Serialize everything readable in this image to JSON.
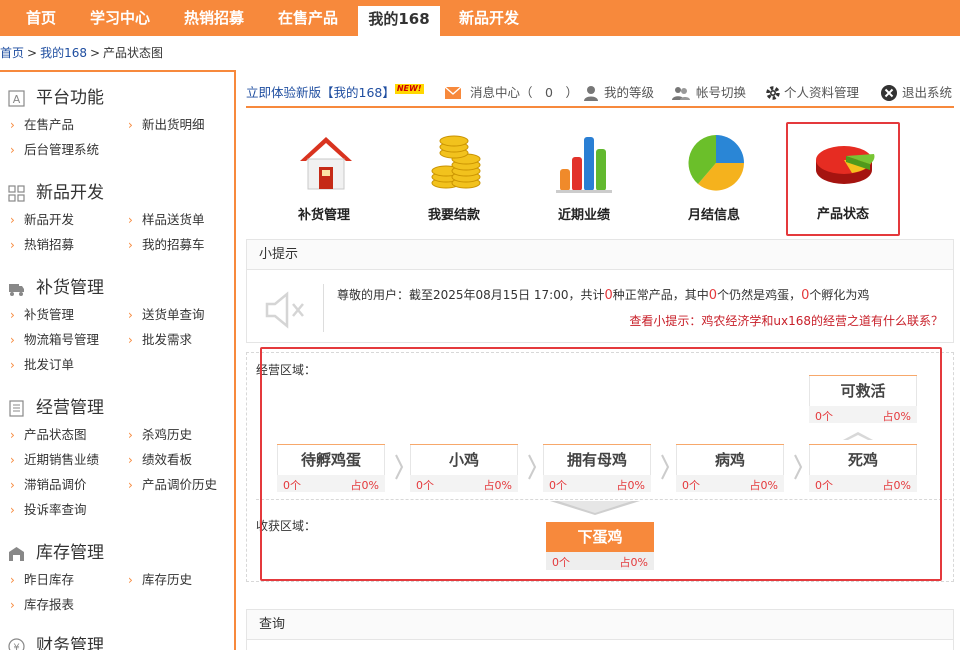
{
  "nav": {
    "tabs": [
      "首页",
      "学习中心",
      "热销招募",
      "在售产品",
      "我的168",
      "新品开发"
    ],
    "active": "我的168"
  },
  "breadcrumb": [
    "首页",
    "我的168",
    "产品状态图"
  ],
  "breadcrumb_sep": ">",
  "sidebar": {
    "sections": [
      {
        "title": "平台功能",
        "icon": "font-a-icon",
        "links": [
          "在售产品",
          "新出货明细",
          "后台管理系统"
        ]
      },
      {
        "title": "新品开发",
        "icon": "grid-icon",
        "links": [
          "新品开发",
          "样品送货单",
          "热销招募",
          "我的招募车"
        ]
      },
      {
        "title": "补货管理",
        "icon": "truck-icon",
        "links": [
          "补货管理",
          "送货单查询",
          "物流箱号管理",
          "批发需求",
          "批发订单"
        ]
      },
      {
        "title": "经营管理",
        "icon": "document-icon",
        "links": [
          "产品状态图",
          "杀鸡历史",
          "近期销售业绩",
          "绩效看板",
          "滞销品调价",
          "产品调价历史",
          "投诉率查询"
        ]
      },
      {
        "title": "库存管理",
        "icon": "warehouse-icon",
        "links": [
          "昨日库存",
          "库存历史",
          "库存报表"
        ]
      },
      {
        "title": "财务管理",
        "icon": "yen-icon",
        "links": []
      }
    ]
  },
  "toolbar": {
    "new_version": "立即体验新版【我的168】",
    "new_badge": "NEW!",
    "messages_label": "消息中心",
    "messages_count": "（　0　）",
    "level": "我的等级",
    "switch_account": "帐号切换",
    "profile": "个人资料管理",
    "logout": "退出系统"
  },
  "features": [
    {
      "label": "补货管理",
      "icon": "house-icon"
    },
    {
      "label": "我要结款",
      "icon": "coins-icon"
    },
    {
      "label": "近期业绩",
      "icon": "bar-chart-icon"
    },
    {
      "label": "月结信息",
      "icon": "pie-chart-icon"
    },
    {
      "label": "产品状态",
      "icon": "pie-3d-icon",
      "active": true
    }
  ],
  "tips": {
    "title": "小提示",
    "p1": "尊敬的用户：截至2025年08月15日 17:00，共计",
    "n1": "0",
    "p2": "种正常产品，其中",
    "n2": "0",
    "p3": "个仍然是鸡蛋，",
    "n3": "0",
    "p4": "个孵化为鸡",
    "link": "查看小提示：鸡农经济学和ux168的经营之道有什么联系？"
  },
  "flow": {
    "zone_business": "经营区域：",
    "zone_harvest": "收获区域：",
    "stages": [
      {
        "name": "待孵鸡蛋",
        "count": "0个",
        "pct": "占0%"
      },
      {
        "name": "小鸡",
        "count": "0个",
        "pct": "占0%"
      },
      {
        "name": "拥有母鸡",
        "count": "0个",
        "pct": "占0%"
      },
      {
        "name": "病鸡",
        "count": "0个",
        "pct": "占0%"
      },
      {
        "name": "死鸡",
        "count": "0个",
        "pct": "占0%"
      },
      {
        "name": "可救活",
        "count": "0个",
        "pct": "占0%"
      },
      {
        "name": "下蛋鸡",
        "count": "0个",
        "pct": "占0%"
      }
    ]
  },
  "query": {
    "title": "查询"
  },
  "colors": {
    "accent": "#f7893c",
    "highlight": "#e4393c",
    "link": "#1f4ea0"
  }
}
